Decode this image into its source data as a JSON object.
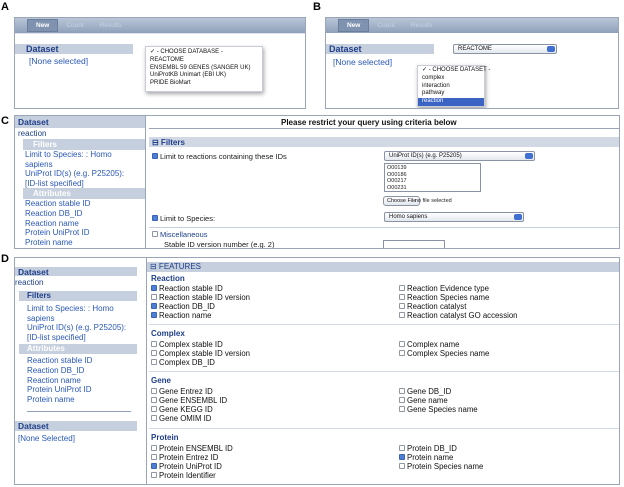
{
  "panel_labels": {
    "a": "A",
    "b": "B",
    "c": "C",
    "d": "D"
  },
  "toolbar": {
    "new": "New",
    "count": "Count",
    "results": "Results"
  },
  "panelA": {
    "dataset_title": "Dataset",
    "none_selected": "[None selected]",
    "dropdown": [
      "✓ - CHOOSE DATABASE -",
      "REACTOME",
      "ENSEMBL 59 GENES (SANGER UK)",
      "UniProtKB Unimart (EBI UK)",
      "PRIDE BioMart"
    ]
  },
  "panelB": {
    "dataset_title": "Dataset",
    "none_selected": "[None selected]",
    "select_value": "REACTOME",
    "dropdown": [
      "✓ - CHOOSE DATASET -",
      "complex",
      "interaction",
      "pathway",
      "reaction"
    ]
  },
  "panelC": {
    "sidebar": {
      "dataset": "Dataset",
      "dataset_value": "reaction",
      "filters": "Filters",
      "filter_items": [
        "Limit to Species: : Homo",
        "sapiens",
        "UniProt ID(s) (e.g. P25205):",
        "[ID-list specified]"
      ],
      "attributes": "Attributes",
      "attribute_items": [
        "Reaction stable ID",
        "Reaction DB_ID",
        "Reaction name",
        "Protein UniProt ID",
        "Protein name"
      ]
    },
    "heading": "Please restrict your query using criteria below",
    "filters_title": "⊟ Filters",
    "limit_ids_label": "Limit to reactions containing these IDs",
    "id_select": "UniProt ID(s) (e.g. P25205)",
    "ids": [
      "O00139",
      "O00186",
      "O00217",
      "O00231"
    ],
    "choose_file": "Choose File",
    "no_file": "no file selected",
    "limit_species_label": "Limit to Species:",
    "species_select": "Homo sapiens",
    "misc_title": "Miscellaneous",
    "stable_id_label": "Stable ID version number (e.g. 2)"
  },
  "panelD": {
    "sidebar": {
      "dataset": "Dataset",
      "dataset_value": "reaction",
      "filters": "Filters",
      "filter_items": [
        "Limit to Species: : Homo",
        "sapiens",
        "UniProt ID(s) (e.g. P25205):",
        "[ID-list specified]"
      ],
      "attributes": "Attributes",
      "attribute_items": [
        "Reaction stable ID",
        "Reaction DB_ID",
        "Reaction name",
        "Protein UniProt ID",
        "Protein name"
      ],
      "dataset2": "Dataset",
      "none_selected": "[None Selected]"
    },
    "features_title": "⊟ FEATURES",
    "groups": {
      "reaction": {
        "title": "Reaction",
        "left": [
          [
            "Reaction stable ID",
            true
          ],
          [
            "Reaction stable ID version",
            false
          ],
          [
            "Reaction DB_ID",
            true
          ],
          [
            "Reaction name",
            true
          ]
        ],
        "right": [
          [
            "Reaction Evidence type",
            false
          ],
          [
            "Reaction Species name",
            false
          ],
          [
            "Reaction catalyst",
            false
          ],
          [
            "Reaction catalyst GO accession",
            false
          ]
        ]
      },
      "complex": {
        "title": "Complex",
        "left": [
          [
            "Complex stable ID",
            false
          ],
          [
            "Complex stable ID version",
            false
          ],
          [
            "Complex DB_ID",
            false
          ]
        ],
        "right": [
          [
            "Complex name",
            false
          ],
          [
            "Complex Species name",
            false
          ]
        ]
      },
      "gene": {
        "title": "Gene",
        "left": [
          [
            "Gene Entrez ID",
            false
          ],
          [
            "Gene ENSEMBL ID",
            false
          ],
          [
            "Gene KEGG ID",
            false
          ],
          [
            "Gene OMIM ID",
            false
          ]
        ],
        "right": [
          [
            "Gene DB_ID",
            false
          ],
          [
            "Gene name",
            false
          ],
          [
            "Gene Species name",
            false
          ]
        ]
      },
      "protein": {
        "title": "Protein",
        "left": [
          [
            "Protein ENSEMBL ID",
            false
          ],
          [
            "Protein Entrez ID",
            false
          ],
          [
            "Protein UniProt ID",
            true
          ],
          [
            "Protein Identifier",
            false
          ]
        ],
        "right": [
          [
            "Protein DB_ID",
            false
          ],
          [
            "Protein name",
            true
          ],
          [
            "Protein Species name",
            false
          ]
        ]
      }
    }
  }
}
